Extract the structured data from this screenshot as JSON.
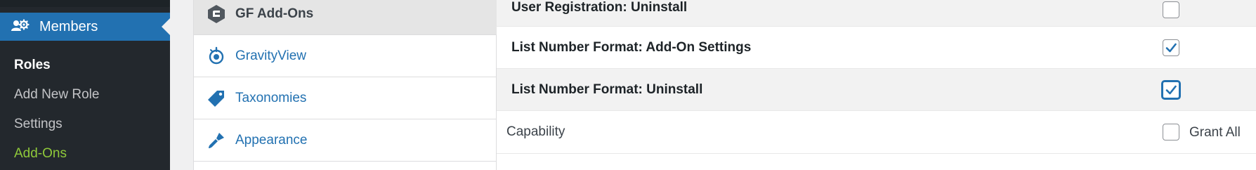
{
  "sidebar": {
    "members_label": "Members",
    "items": [
      {
        "label": "Roles"
      },
      {
        "label": "Add New Role"
      },
      {
        "label": "Settings"
      },
      {
        "label": "Add-Ons"
      }
    ]
  },
  "tabs": [
    {
      "label": "GF Add-Ons",
      "icon": "gravity-forms-icon"
    },
    {
      "label": "GravityView",
      "icon": "gravityview-icon"
    },
    {
      "label": "Taxonomies",
      "icon": "tag-icon"
    },
    {
      "label": "Appearance",
      "icon": "paintbrush-icon"
    }
  ],
  "capabilities": [
    {
      "name": "User Registration: Uninstall",
      "checked": false
    },
    {
      "name": "List Number Format: Add-On Settings",
      "checked": true
    },
    {
      "name": "List Number Format: Uninstall",
      "checked": true
    }
  ],
  "table_header": {
    "capability_label": "Capability",
    "grant_all_label": "Grant All"
  },
  "colors": {
    "accent": "#2271b1",
    "sidebar_bg": "#23282d",
    "addons_green": "#8fc93a"
  }
}
